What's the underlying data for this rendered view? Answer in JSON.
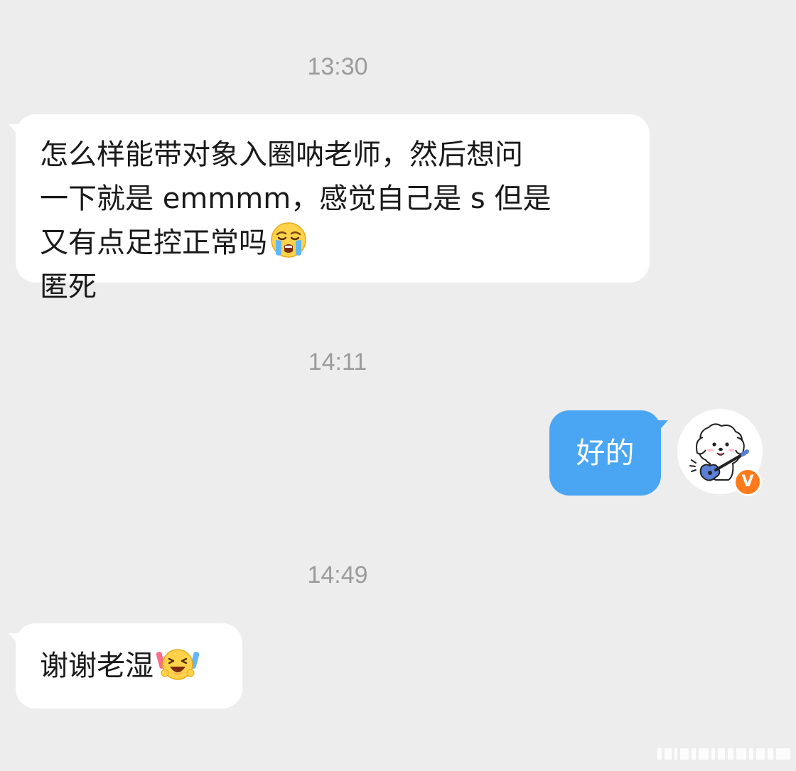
{
  "chat": {
    "timestamps": [
      "13:30",
      "14:11",
      "14:49"
    ],
    "messages": [
      {
        "side": "incoming",
        "lines": [
          "怎么样能带对象入圈呐老师，然后想问",
          "一下就是 emmmm，感觉自己是 s 但是",
          "又有点足控正常吗",
          "匿死"
        ],
        "emoji": "loudly-crying-face"
      },
      {
        "side": "outgoing",
        "text": "好的"
      },
      {
        "side": "incoming",
        "text": "谢谢老湿",
        "emoji": "cheering-face-with-glowsticks"
      }
    ]
  },
  "avatar": {
    "icon": "dog-playing-guitar-avatar",
    "badge": "V",
    "badge_color": "#ff7a1a"
  },
  "colors": {
    "background": "#ededed",
    "incoming_bubble": "#ffffff",
    "outgoing_bubble": "#4aa6f3",
    "timestamp_text": "#9b9b9b"
  }
}
